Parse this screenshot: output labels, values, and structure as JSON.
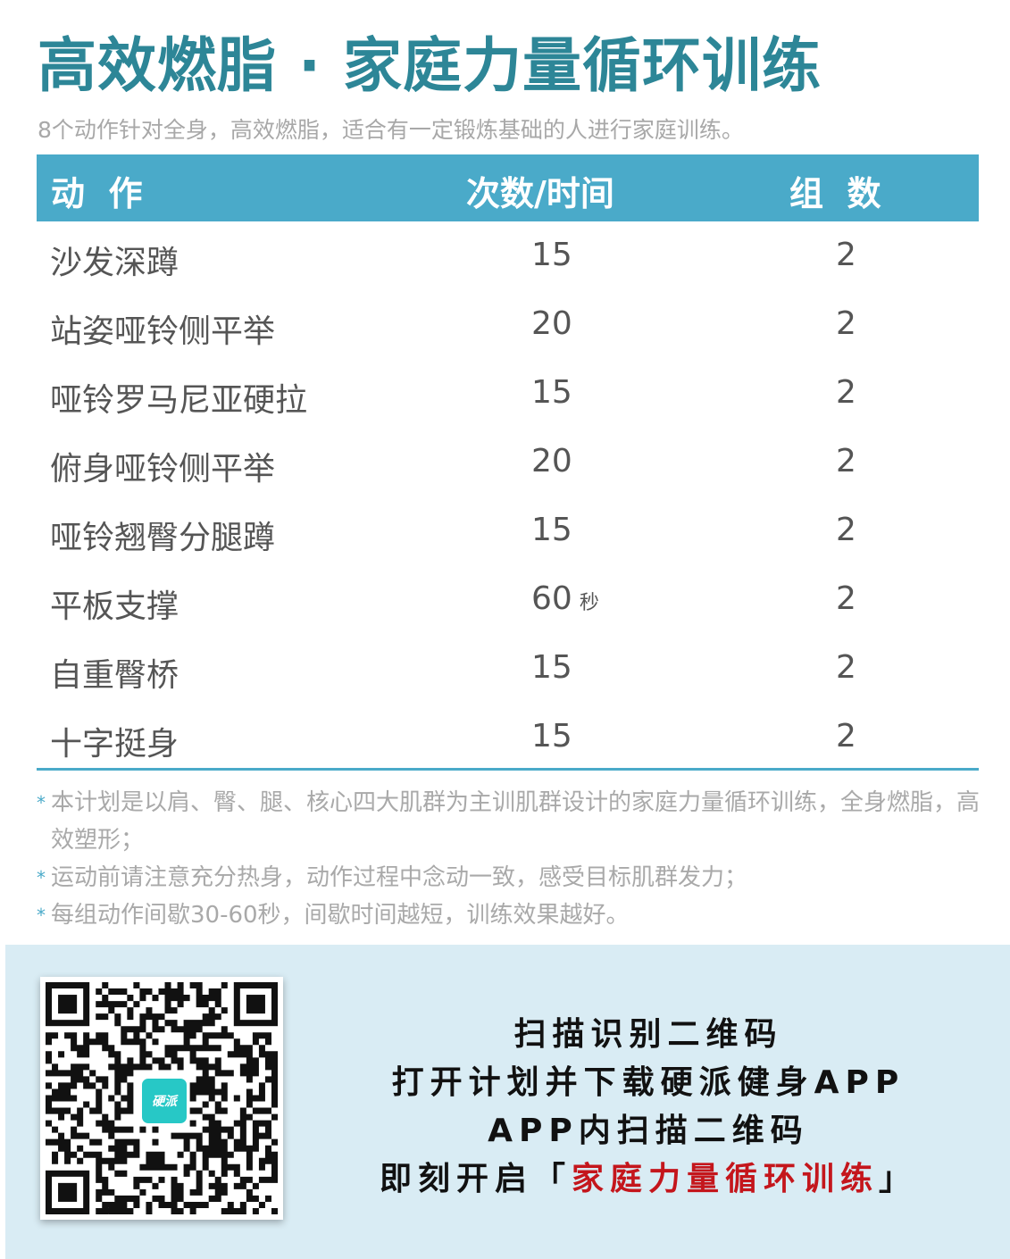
{
  "title": "高效燃脂 · 家庭力量循环训练",
  "subtitle": "8个动作针对全身，高效燃脂，适合有一定锻炼基础的人进行家庭训练。",
  "table": {
    "headers": {
      "action": "动  作",
      "reps": "次数/时间",
      "sets": "组  数"
    },
    "rows": [
      {
        "name": "沙发深蹲",
        "reps": "15",
        "unit": "",
        "sets": "2"
      },
      {
        "name": "站姿哑铃侧平举",
        "reps": "20",
        "unit": "",
        "sets": "2"
      },
      {
        "name": "哑铃罗马尼亚硬拉",
        "reps": "15",
        "unit": "",
        "sets": "2"
      },
      {
        "name": "俯身哑铃侧平举",
        "reps": "20",
        "unit": "",
        "sets": "2"
      },
      {
        "name": "哑铃翘臀分腿蹲",
        "reps": "15",
        "unit": "",
        "sets": "2"
      },
      {
        "name": "平板支撑",
        "reps": "60",
        "unit": "秒",
        "sets": "2"
      },
      {
        "name": "自重臀桥",
        "reps": "15",
        "unit": "",
        "sets": "2"
      },
      {
        "name": "十字挺身",
        "reps": "15",
        "unit": "",
        "sets": "2"
      }
    ]
  },
  "notes": {
    "bullet": "*",
    "items": [
      "本计划是以肩、臀、腿、核心四大肌群为主训肌群设计的家庭力量循环训练，全身燃脂，高效塑形；",
      "运动前请注意充分热身，动作过程中念动一致，感受目标肌群发力；",
      "每组动作间歇30-60秒，间歇时间越短，训练效果越好。"
    ]
  },
  "footer": {
    "qr_logo_text": "硬派",
    "cta": {
      "line1": "扫描识别二维码",
      "line2": "打开计划并下载硬派健身APP",
      "line3": "APP内扫描二维码",
      "line4_prefix": "即刻开启「",
      "line4_highlight": "家庭力量循环训练",
      "line4_suffix": "」"
    }
  },
  "colors": {
    "title": "#2d8697",
    "header_bg": "#4aaac9",
    "footer_bg": "#d9ecf4",
    "highlight": "#c4161c"
  }
}
